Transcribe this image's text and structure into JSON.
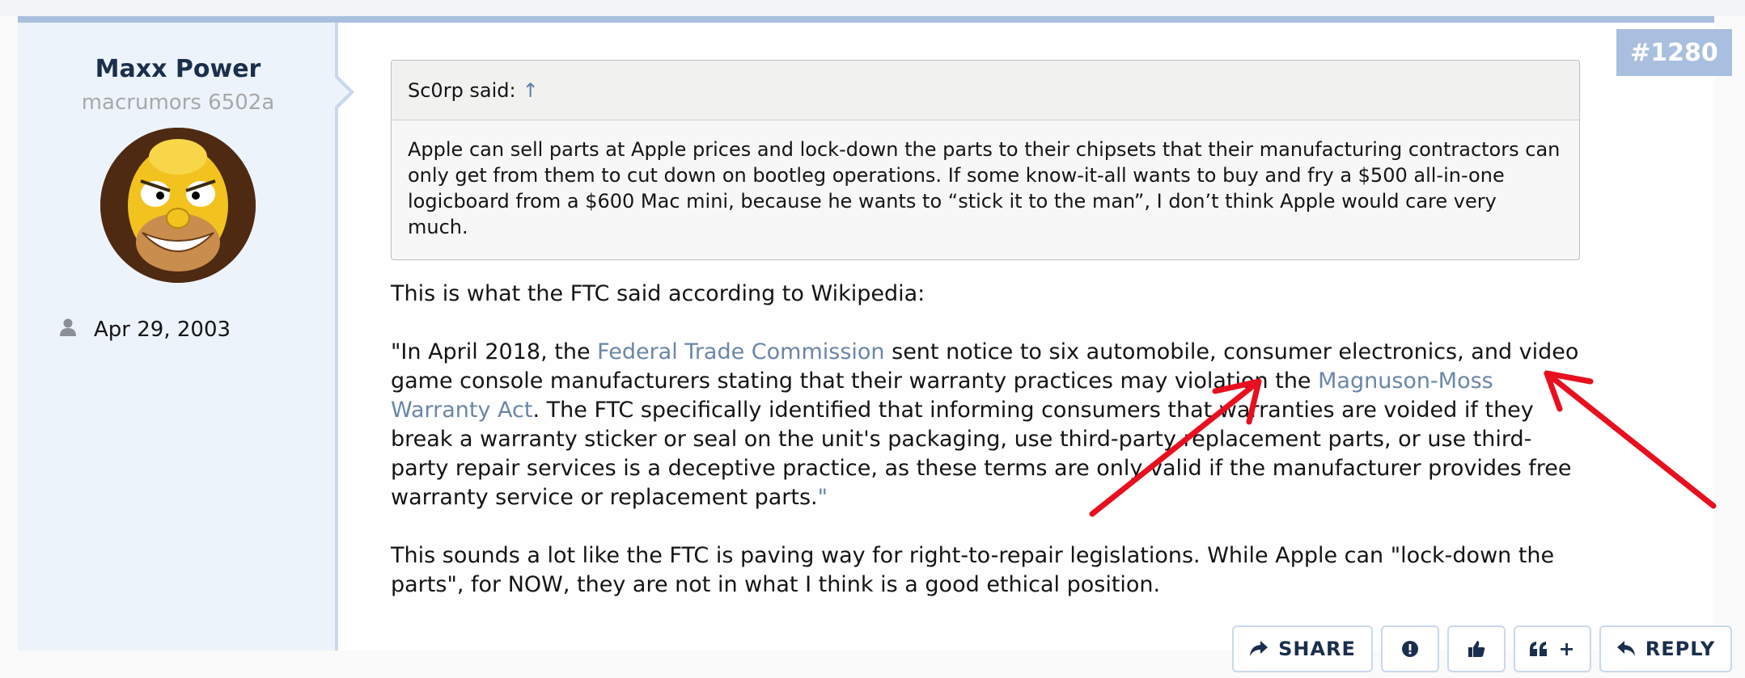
{
  "post": {
    "number": "#1280",
    "author": {
      "name": "Maxx Power",
      "title": "macrumors 6502a",
      "joined": "Apr 29, 2003"
    },
    "quote": {
      "attribution": "Sc0rp said:",
      "up_arrow": "↑",
      "text": "Apple can sell parts at Apple prices and lock-down the parts to their chipsets that their manufacturing contractors can only get from them to cut down on bootleg operations. If some know-it-all wants to buy and fry a $500 all-in-one logicboard from a $600 Mac mini, because he wants to “stick it to the man”, I don’t think Apple would care very much."
    },
    "paragraph1": "This is what the FTC said according to Wikipedia:",
    "paragraph2": {
      "part1": "\"In April 2018, the ",
      "link1": "Federal Trade Commission",
      "part2": " sent notice to six automobile, consumer electronics, and video game console manufacturers stating that their warranty practices may violation the ",
      "link2": "Magnuson-Moss Warranty Act",
      "part3": ". The FTC specifically identified that informing consumers that warranties are voided if they break a warranty sticker or seal on the unit's packaging, use third-party replacement parts, or use third-party repair services is a deceptive practice, as these terms are only valid if the manufacturer provides free warranty service or replacement parts.",
      "link3": "\""
    },
    "paragraph3": "This sounds a lot like the FTC is paving way for right-to-repair legislations. While Apple can \"lock-down the parts\", for NOW, they are not in what I think is a good ethical position."
  },
  "actions": {
    "share_label": "SHARE",
    "reply_label": "REPLY",
    "multiquote_plus": "+"
  },
  "colors": {
    "accent": "#a9bfdf",
    "link": "#6a86a8",
    "annotation_arrow": "#e8101e"
  },
  "icons": [
    "user-icon",
    "share-icon",
    "report-icon",
    "like-icon",
    "multiquote-icon",
    "reply-icon"
  ]
}
